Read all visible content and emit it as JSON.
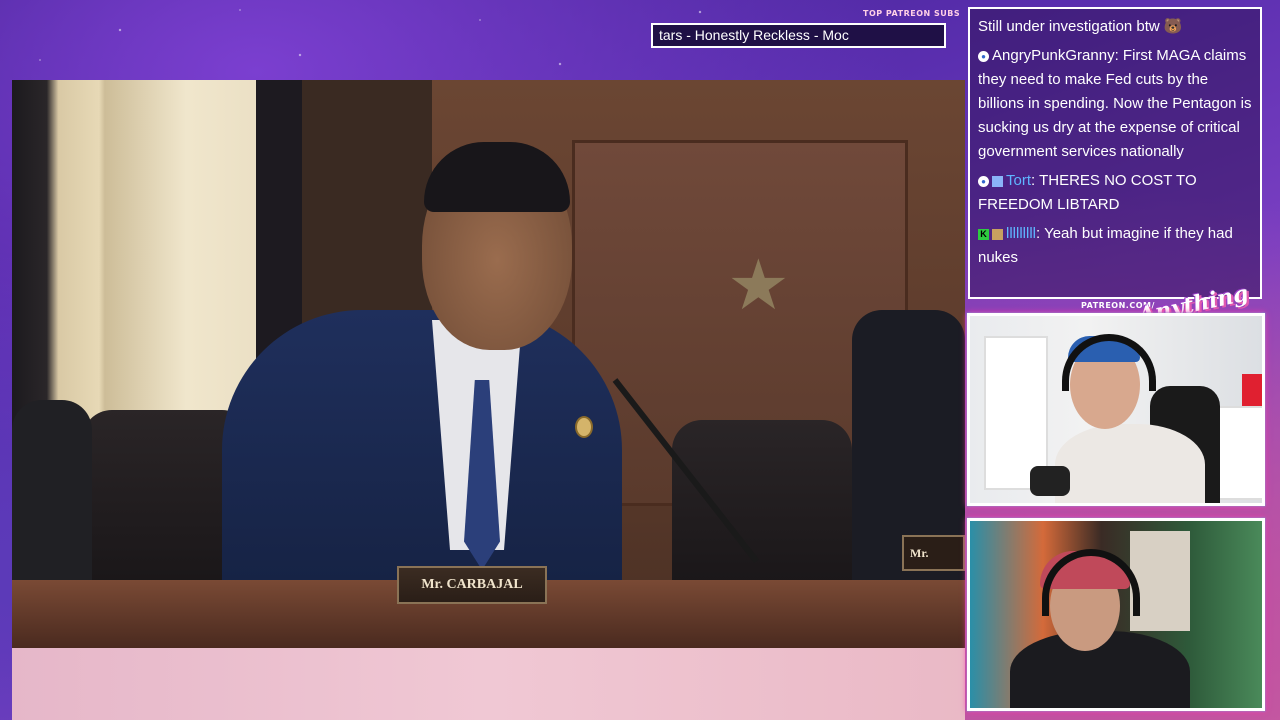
{
  "ticker": {
    "label": "TOP PATREON SUBS",
    "text": "tars - Honestly Reckless - Moc"
  },
  "video": {
    "placard_main": "Mr. CARBAJAL",
    "placard_side": "Mr."
  },
  "chat": {
    "messages": [
      {
        "user": "",
        "text": "Still under investigation btw 🐻"
      },
      {
        "user": "AngryPunkGranny",
        "text": ": First MAGA claims they need to make Fed cuts by the billions in spending. Now the Pentagon is sucking us dry at the expense of critical government services nationally"
      },
      {
        "user": "Tort",
        "text": ": THERES NO COST TO FREEDOM LIBTARD"
      },
      {
        "user": "lllllllll",
        "text": ": Yeah but imagine if they had nukes"
      }
    ]
  },
  "overlay": {
    "patreon_label": "PATREON.COM/",
    "logo_text": "Anything Else?"
  },
  "colors": {
    "background_purple": "#5b2fb0",
    "frame_white": "#ffffff",
    "username_blue": "#5fb6ff",
    "bottom_band_pink": "#f0c8d4"
  }
}
